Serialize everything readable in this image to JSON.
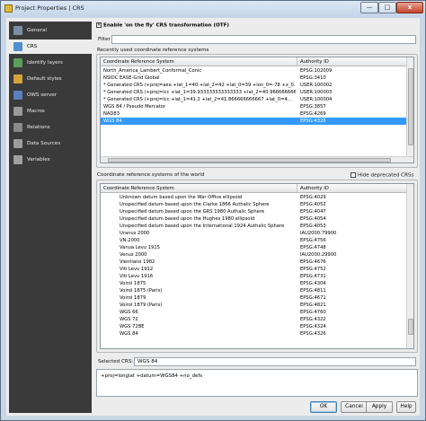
{
  "window": {
    "title": "Project Properties | CRS",
    "controls": {
      "minimize": "—",
      "maximize": "□",
      "close": "x"
    }
  },
  "sidebar": {
    "items": [
      {
        "label": "General",
        "icon": "general-icon",
        "color": "#7a8fa6"
      },
      {
        "label": "CRS",
        "icon": "crs-globe-icon",
        "color": "#4f8fcf",
        "active": true
      },
      {
        "label": "Identify layers",
        "icon": "identify-icon",
        "color": "#5aa05a"
      },
      {
        "label": "Default styles",
        "icon": "styles-icon",
        "color": "#d4a23a"
      },
      {
        "label": "OWS server",
        "icon": "server-icon",
        "color": "#5b7fbf"
      },
      {
        "label": "Macros",
        "icon": "macros-icon",
        "color": "#9a9a9a"
      },
      {
        "label": "Relations",
        "icon": "relations-icon",
        "color": "#8a8a8a"
      },
      {
        "label": "Data Sources",
        "icon": "data-sources-icon",
        "color": "#9c9c9c"
      },
      {
        "label": "Variables",
        "icon": "variables-icon",
        "color": "#a0a0a0"
      }
    ]
  },
  "crs": {
    "otf_label": "Enable 'on the fly' CRS transformation (OTF)",
    "otf_checked_mark": "✕",
    "filter_label": "Filter",
    "filter_value": "",
    "recent_label": "Recently used coordinate reference systems",
    "columns": [
      "Coordinate Reference System",
      "Authority ID"
    ],
    "recent_rows": [
      [
        "North_America_Lambert_Conformal_Conic",
        "EPSG:102009"
      ],
      [
        "NSIDC EASE-Grid Global",
        "EPSG:3410"
      ],
      [
        "* Generated CRS (+proj=aea +lat_1=40 +lat_2=42 +lat_0=39 +lon_0=-78 +x_0...",
        "USER:100002"
      ],
      [
        "* Generated CRS (+proj=lcc +lat_1=39.933333333333333 +lat_2=40.9666666666...",
        "USER:100003"
      ],
      [
        "* Generated CRS (+proj=lcc +lat_1=41.2 +lat_2=41.866666666667 +lat_0=4...",
        "USER:100004"
      ],
      [
        "WGS 84 / Pseudo Mercator",
        "EPSG:3857"
      ],
      [
        "NAD83",
        "EPSG:4269"
      ],
      [
        "WGS 84",
        "EPSG:4326"
      ]
    ],
    "world_label": "Coordinate reference systems of the world",
    "hide_deprecated_label": "Hide deprecated CRSs",
    "world_rows": [
      [
        "Unknown datum based upon the War Office ellipsoid",
        "EPSG:4029"
      ],
      [
        "Unspecified datum based upon the Clarke 1866 Authalic Sphere",
        "EPSG:4052"
      ],
      [
        "Unspecified datum based upon the GRS 1980 Authalic Sphere",
        "EPSG:4047"
      ],
      [
        "Unspecified datum based upon the Hughes 1980 ellipsoid",
        "EPSG:4054"
      ],
      [
        "Unspecified datum based upon the International 1924 Authalic Sphere",
        "EPSG:4053"
      ],
      [
        "Uranus 2000",
        "IAU2000:79900"
      ],
      [
        "VN-2000",
        "EPSG:4756"
      ],
      [
        "Vanua Levu 1915",
        "EPSG:4748"
      ],
      [
        "Venus 2000",
        "IAU2000:29900"
      ],
      [
        "Vientiane 1982",
        "EPSG:4676"
      ],
      [
        "Viti Levu 1912",
        "EPSG:4752"
      ],
      [
        "Viti Levu 1916",
        "EPSG:4731"
      ],
      [
        "Voirol 1875",
        "EPSG:4304"
      ],
      [
        "Voirol 1875 (Paris)",
        "EPSG:4811"
      ],
      [
        "Voirol 1879",
        "EPSG:4671"
      ],
      [
        "Voirol 1879 (Paris)",
        "EPSG:4821"
      ],
      [
        "WGS 66",
        "EPSG:4760"
      ],
      [
        "WGS 72",
        "EPSG:4322"
      ],
      [
        "WGS 72BE",
        "EPSG:4324"
      ],
      [
        "WGS 84",
        "EPSG:4326"
      ]
    ],
    "selected_label": "Selected CRS:",
    "selected_value": "WGS 84",
    "proj_string": "+proj=longlat +datum=WGS84 +no_defs"
  },
  "buttons": {
    "ok": "OK",
    "cancel": "Cancel",
    "apply": "Apply",
    "help": "Help"
  }
}
